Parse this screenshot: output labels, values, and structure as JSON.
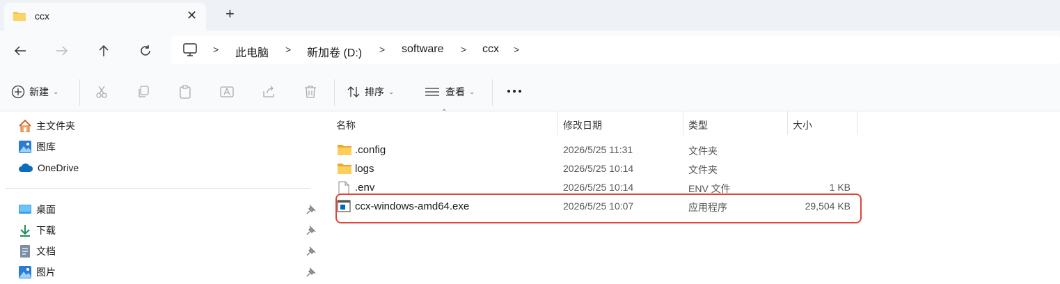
{
  "tab": {
    "title": "ccx"
  },
  "address": {
    "items": [
      "此电脑",
      "新加卷 (D:)",
      "software",
      "ccx"
    ]
  },
  "toolbar": {
    "new_label": "新建",
    "sort_label": "排序",
    "view_label": "查看"
  },
  "sidebar": {
    "pinned": [
      {
        "label": "主文件夹",
        "icon": "home-icon"
      },
      {
        "label": "图库",
        "icon": "gallery-icon"
      },
      {
        "label": "OneDrive",
        "icon": "onedrive-icon"
      }
    ],
    "quick": [
      {
        "label": "桌面",
        "icon": "desktop-icon"
      },
      {
        "label": "下载",
        "icon": "download-icon"
      },
      {
        "label": "文档",
        "icon": "document-icon"
      },
      {
        "label": "图片",
        "icon": "pictures-icon"
      }
    ]
  },
  "columns": {
    "name": "名称",
    "date": "修改日期",
    "type": "类型",
    "size": "大小"
  },
  "files": [
    {
      "name": ".config",
      "date": "2026/5/25 11:31",
      "type": "文件夹",
      "size": "",
      "icon": "folder-icon"
    },
    {
      "name": "logs",
      "date": "2026/5/25 10:14",
      "type": "文件夹",
      "size": "",
      "icon": "folder-icon"
    },
    {
      "name": ".env",
      "date": "2026/5/25 10:14",
      "type": "ENV 文件",
      "size": "1 KB",
      "icon": "file-icon"
    },
    {
      "name": "ccx-windows-amd64.exe",
      "date": "2026/5/25 10:07",
      "type": "应用程序",
      "size": "29,504 KB",
      "icon": "exe-icon"
    }
  ],
  "colors": {
    "accent": "#0067c0",
    "highlight": "#e0443a",
    "folder": "#f8c54c"
  }
}
